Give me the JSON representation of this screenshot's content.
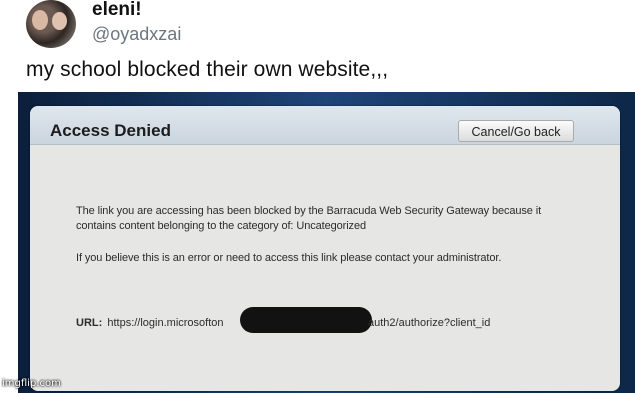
{
  "tweet": {
    "display_name": "eleni!",
    "handle": "@oyadxzai",
    "text": "my school blocked their own website,,,"
  },
  "dialog": {
    "title": "Access Denied",
    "cancel_label": "Cancel/Go back",
    "message_1": "The link you are accessing has been blocked by the Barracuda Web Security Gateway because it contains content belonging to the category of: Uncategorized",
    "message_2": "If you believe this is an error or need to access this link please contact your administrator.",
    "url_label": "URL:",
    "url_start": "https://login.microsofton",
    "url_end": "auth2/authorize?client_id"
  },
  "watermark": "imgflip.com",
  "colors": {
    "photo_background": "#10284a",
    "dialog_background": "#e6e7e4",
    "redaction": "#121212"
  }
}
